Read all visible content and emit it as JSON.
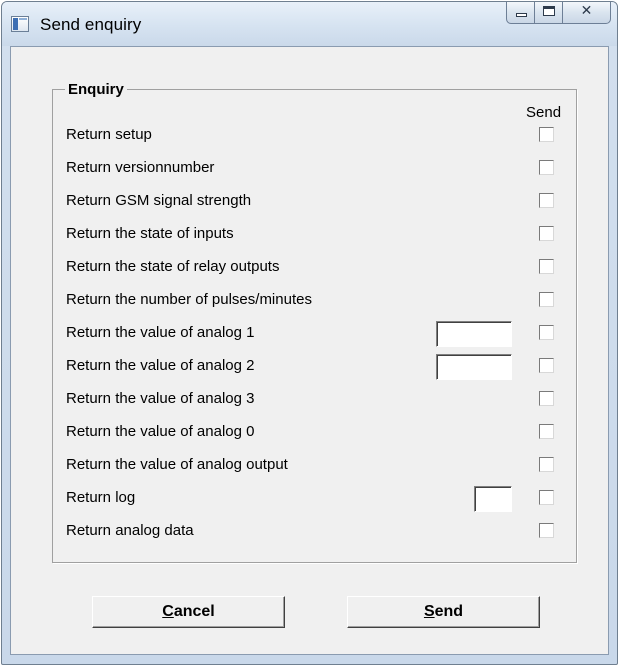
{
  "window": {
    "title": "Send enquiry",
    "controls": {
      "minimize": "minimize",
      "maximize": "maximize",
      "close": "✕"
    }
  },
  "groupbox": {
    "title": "Enquiry",
    "send_column_header": "Send",
    "rows": [
      {
        "label": "Return setup",
        "checked": false
      },
      {
        "label": "Return versionnumber",
        "checked": false
      },
      {
        "label": "Return GSM signal strength",
        "checked": false
      },
      {
        "label": "Return the state of inputs",
        "checked": false
      },
      {
        "label": "Return the state of relay outputs",
        "checked": false
      },
      {
        "label": "Return the number of pulses/minutes",
        "checked": false
      },
      {
        "label": "Return the value of analog 1",
        "checked": false,
        "input": {
          "value": ""
        }
      },
      {
        "label": "Return the value of analog 2",
        "checked": false,
        "input": {
          "value": ""
        }
      },
      {
        "label": "Return the value of analog 3",
        "checked": false
      },
      {
        "label": "Return the value of analog 0",
        "checked": false
      },
      {
        "label": "Return the value of analog output",
        "checked": false
      },
      {
        "label": "Return log",
        "checked": false,
        "input": {
          "value": ""
        }
      },
      {
        "label": "Return analog data",
        "checked": false
      }
    ]
  },
  "buttons": {
    "cancel": {
      "mnemonic": "C",
      "rest": "ancel"
    },
    "send": {
      "mnemonic": "S",
      "rest": "end"
    }
  }
}
